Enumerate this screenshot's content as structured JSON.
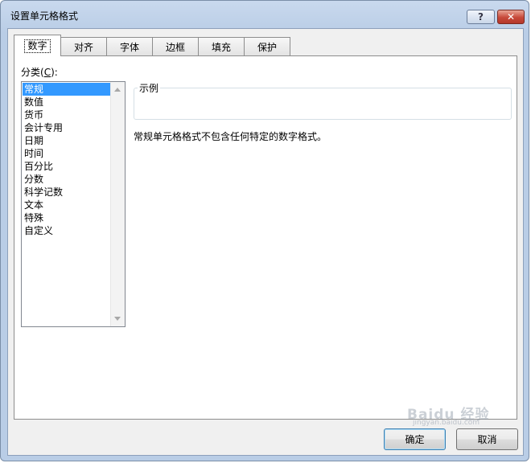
{
  "window": {
    "title": "设置单元格格式",
    "help_label": "?",
    "close_label": "✕"
  },
  "tabs": [
    {
      "label": "数字",
      "active": true
    },
    {
      "label": "对齐",
      "active": false
    },
    {
      "label": "字体",
      "active": false
    },
    {
      "label": "边框",
      "active": false
    },
    {
      "label": "填充",
      "active": false
    },
    {
      "label": "保护",
      "active": false
    }
  ],
  "category": {
    "label_prefix": "分类(",
    "label_key": "C",
    "label_suffix": "):",
    "items": [
      "常规",
      "数值",
      "货币",
      "会计专用",
      "日期",
      "时间",
      "百分比",
      "分数",
      "科学记数",
      "文本",
      "特殊",
      "自定义"
    ],
    "selected": "常规"
  },
  "sample": {
    "legend": "示例",
    "value": ""
  },
  "description": "常规单元格格式不包含任何特定的数字格式。",
  "buttons": {
    "ok": "确定",
    "cancel": "取消"
  },
  "watermark": {
    "text": "Baidu 经验",
    "sub": "jingyan.baidu.com"
  },
  "colors": {
    "selection": "#3399ff",
    "close_button": "#c7493a",
    "title_bar": "#c9d9ee"
  }
}
